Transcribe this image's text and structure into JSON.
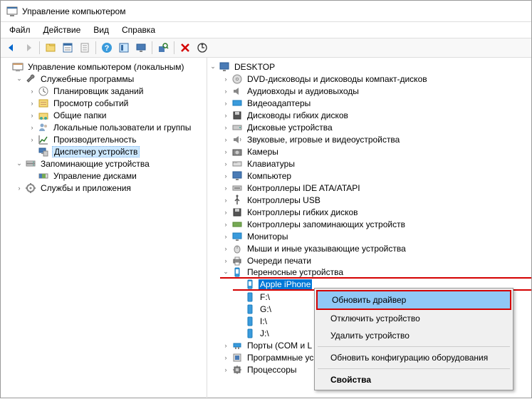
{
  "window": {
    "title": "Управление компьютером"
  },
  "menubar": {
    "file": "Файл",
    "action": "Действие",
    "view": "Вид",
    "help": "Справка"
  },
  "left_tree": {
    "root": "Управление компьютером (локальным)",
    "system_tools": "Служебные программы",
    "task_scheduler": "Планировщик заданий",
    "event_viewer": "Просмотр событий",
    "shared_folders": "Общие папки",
    "local_users": "Локальные пользователи и группы",
    "performance": "Производительность",
    "device_manager": "Диспетчер устройств",
    "storage": "Запоминающие устройства",
    "disk_mgmt": "Управление дисками",
    "services_apps": "Службы и приложения"
  },
  "right_tree": {
    "root": "DESKTOP",
    "dvd": "DVD-дисководы и дисководы компакт-дисков",
    "audio": "Аудиовходы и аудиовыходы",
    "video": "Видеоадаптеры",
    "floppy": "Дисководы гибких дисков",
    "disk_devices": "Дисковые устройства",
    "sound": "Звуковые, игровые и видеоустройства",
    "cameras": "Камеры",
    "keyboards": "Клавиатуры",
    "computer": "Компьютер",
    "ide": "Контроллеры IDE ATA/ATAPI",
    "usb": "Контроллеры USB",
    "floppy_ctrl": "Контроллеры гибких дисков",
    "storage_ctrl": "Контроллеры запоминающих устройств",
    "monitors": "Мониторы",
    "mice": "Мыши и иные указывающие устройства",
    "print_queues": "Очереди печати",
    "portable": "Переносные устройства",
    "device_iphone": "Apple iPhone",
    "device_f": "F:\\",
    "device_g": "G:\\",
    "device_i": "I:\\",
    "device_j": "J:\\",
    "ports": "Порты (COM и L",
    "software": "Программные ус",
    "processors": "Процессоры"
  },
  "context_menu": {
    "update_driver": "Обновить драйвер",
    "disable": "Отключить устройство",
    "uninstall": "Удалить устройство",
    "scan": "Обновить конфигурацию оборудования",
    "properties": "Свойства"
  }
}
